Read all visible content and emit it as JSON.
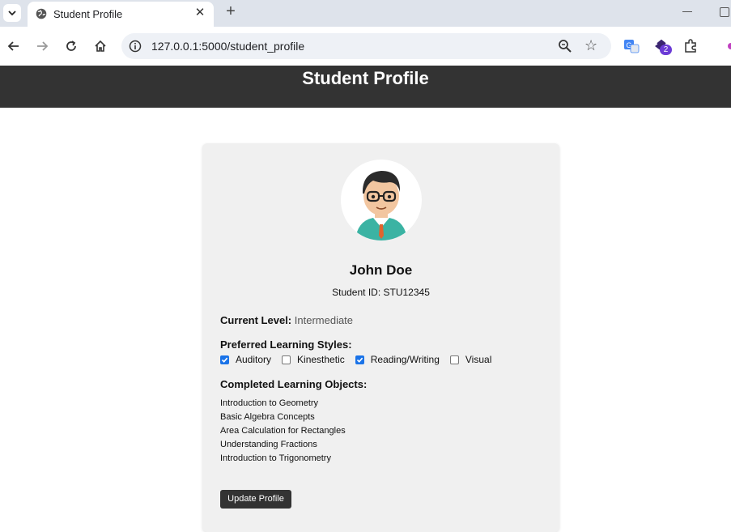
{
  "browser": {
    "tab_title": "Student Profile",
    "url": "127.0.0.1:5000/student_profile",
    "extension_badge": "2"
  },
  "header": {
    "title": "Student Profile"
  },
  "profile": {
    "name": "John Doe",
    "student_id": "Student ID: STU12345",
    "level_label": "Current Level:",
    "level_value": "Intermediate",
    "styles_label": "Preferred Learning Styles:",
    "styles": [
      {
        "label": "Auditory",
        "checked": true
      },
      {
        "label": "Kinesthetic",
        "checked": false
      },
      {
        "label": "Reading/Writing",
        "checked": true
      },
      {
        "label": "Visual",
        "checked": false
      }
    ],
    "completed_label": "Completed Learning Objects:",
    "completed": [
      "Introduction to Geometry",
      "Basic Algebra Concepts",
      "Area Calculation for Rectangles",
      "Understanding Fractions",
      "Introduction to Trigonometry"
    ],
    "update_button": "Update Profile"
  }
}
